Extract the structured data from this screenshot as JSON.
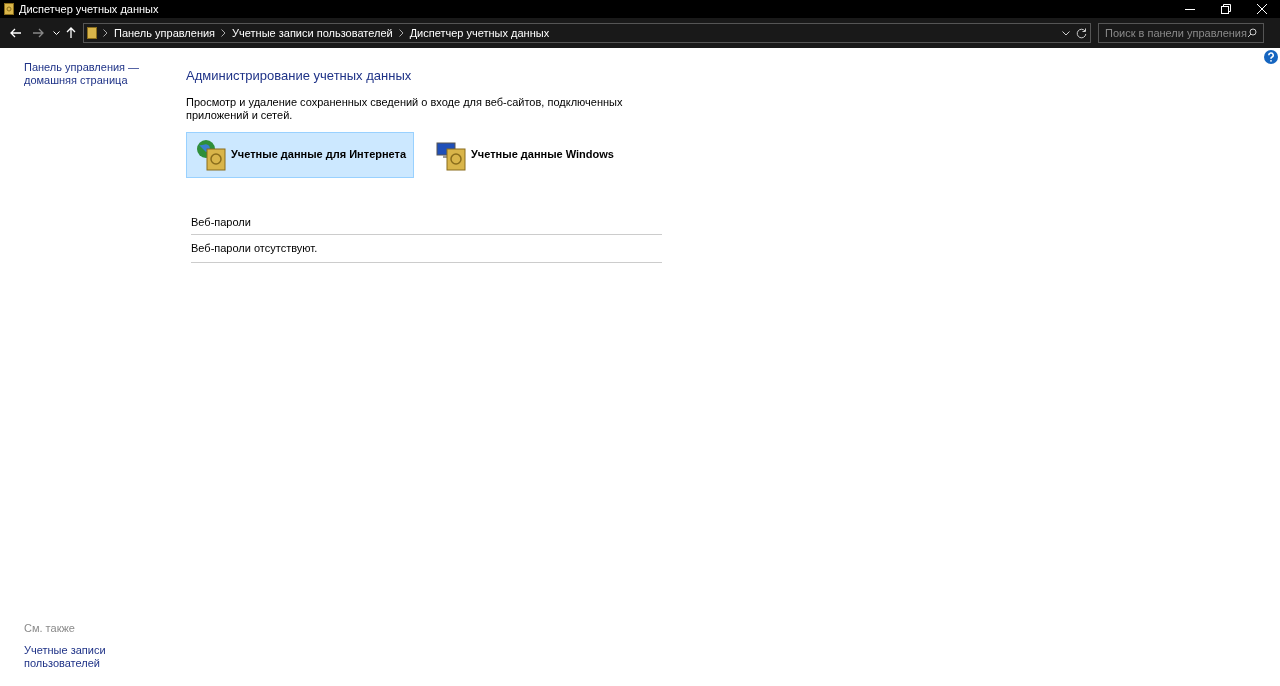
{
  "window": {
    "title": "Диспетчер учетных данных"
  },
  "breadcrumbs": [
    "Панель управления",
    "Учетные записи пользователей",
    "Диспетчер учетных данных"
  ],
  "search": {
    "placeholder": "Поиск в панели управления"
  },
  "sidebar": {
    "home_link": "Панель управления — домашняя страница",
    "see_also_heading": "См. также",
    "see_also_links": [
      "Учетные записи пользователей"
    ]
  },
  "main": {
    "heading": "Администрирование учетных данных",
    "description": "Просмотр и удаление сохраненных сведений о входе для веб-сайтов, подключенных приложений и сетей.",
    "tiles": [
      {
        "kind": "web",
        "label": "Учетные данные для Интернета",
        "selected": true
      },
      {
        "kind": "windows",
        "label": "Учетные данные Windows",
        "selected": false
      }
    ],
    "section": {
      "title": "Веб-пароли",
      "message": "Веб-пароли отсутствуют."
    }
  }
}
